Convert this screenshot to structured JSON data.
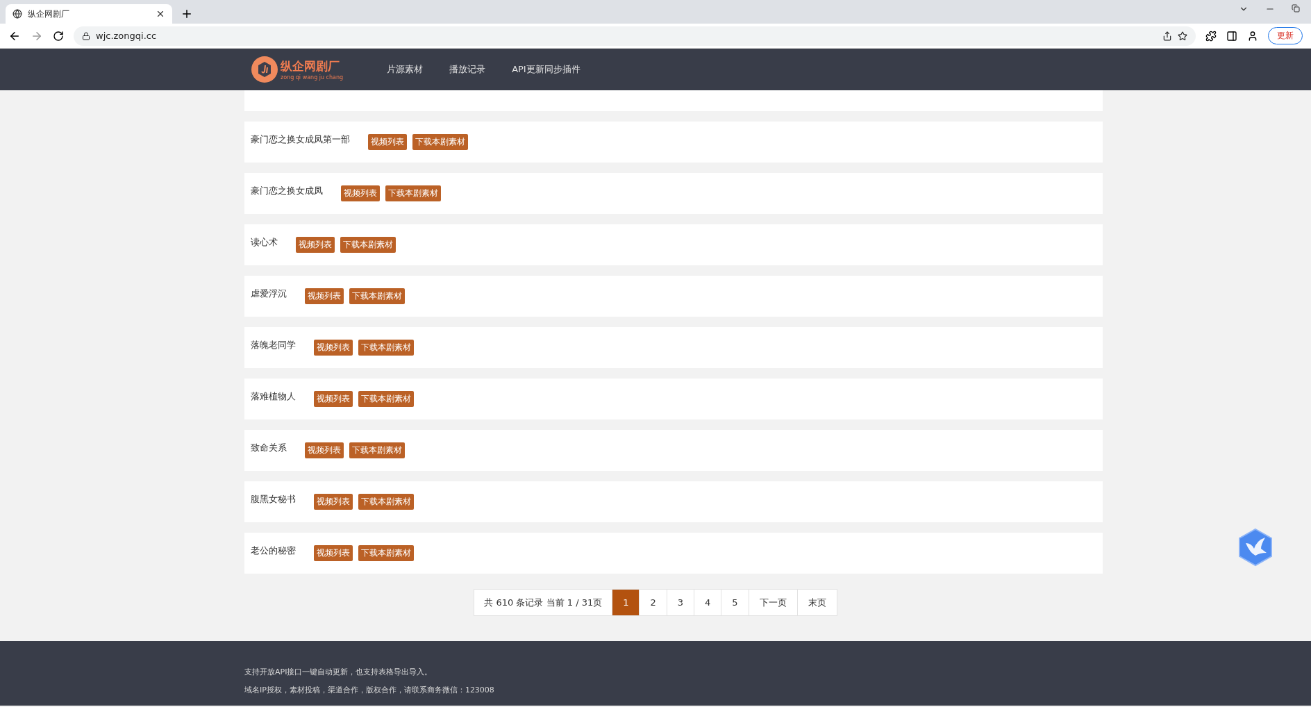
{
  "browser": {
    "tab_title": "纵企网剧厂",
    "url": "wjc.zongqi.cc",
    "update_button": "更新"
  },
  "header": {
    "logo_title": "纵企网剧厂",
    "logo_subtitle": "zong qi wang ju chang",
    "nav": [
      {
        "label": "片源素材"
      },
      {
        "label": "播放记录"
      },
      {
        "label": "API更新同步插件"
      }
    ]
  },
  "rows": [
    {
      "title": "豪门恋之换女成凤第一部",
      "buttons": [
        "视频列表",
        "下载本剧素材"
      ]
    },
    {
      "title": "豪门恋之换女成凤",
      "buttons": [
        "视频列表",
        "下载本剧素材"
      ]
    },
    {
      "title": "读心术",
      "buttons": [
        "视频列表",
        "下载本剧素材"
      ]
    },
    {
      "title": "虐爱浮沉",
      "buttons": [
        "视频列表",
        "下载本剧素材"
      ]
    },
    {
      "title": "落魄老同学",
      "buttons": [
        "视频列表",
        "下载本剧素材"
      ]
    },
    {
      "title": "落难植物人",
      "buttons": [
        "视频列表",
        "下载本剧素材"
      ]
    },
    {
      "title": "致命关系",
      "buttons": [
        "视频列表",
        "下载本剧素材"
      ]
    },
    {
      "title": "腹黑女秘书",
      "buttons": [
        "视频列表",
        "下载本剧素材"
      ]
    },
    {
      "title": "老公的秘密",
      "buttons": [
        "视频列表",
        "下载本剧素材"
      ]
    }
  ],
  "pagination": {
    "summary": "共 610 条记录 当前 1 / 31页",
    "pages": [
      {
        "label": "1",
        "selected": true
      },
      {
        "label": "2",
        "selected": false
      },
      {
        "label": "3",
        "selected": false
      },
      {
        "label": "4",
        "selected": false
      },
      {
        "label": "5",
        "selected": false
      }
    ],
    "next": "下一页",
    "last": "末页"
  },
  "footer": {
    "lines": [
      "支持开放API接口一键自动更新，也支持表格导出导入。",
      "域名IP授权，素材投稿，渠道合作，版权合作，请联系商务微信：123008"
    ]
  }
}
